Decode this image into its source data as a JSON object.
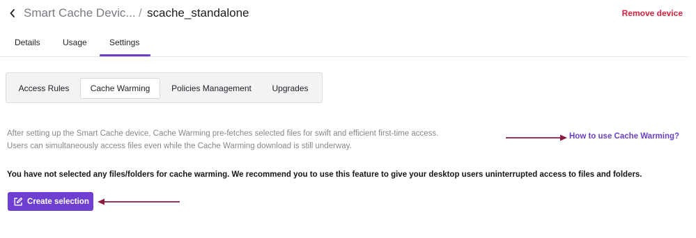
{
  "header": {
    "breadcrumb_parent": "Smart Cache Devic...",
    "breadcrumb_separator": "/",
    "breadcrumb_current": "scache_standalone",
    "remove_label": "Remove device"
  },
  "tabs": [
    {
      "label": "Details",
      "active": false
    },
    {
      "label": "Usage",
      "active": false
    },
    {
      "label": "Settings",
      "active": true
    }
  ],
  "subtabs": [
    {
      "label": "Access Rules",
      "active": false
    },
    {
      "label": "Cache Warming",
      "active": true
    },
    {
      "label": "Policies Management",
      "active": false
    },
    {
      "label": "Upgrades",
      "active": false
    }
  ],
  "content": {
    "description_line1": "After setting up the Smart Cache device, Cache Warming pre-fetches selected files for swift and efficient first-time access.",
    "description_line2": "Users can simultaneously access files even while the Cache Warming download is still underway.",
    "help_link": "How to use Cache Warming?",
    "empty_notice": "You have not selected any files/folders for cache warming. We recommend you to use this feature to give your desktop users uninterrupted access to files and folders.",
    "create_button": "Create selection"
  },
  "icons": {
    "back": "chevron-left-icon",
    "create": "edit-square-icon"
  },
  "colors": {
    "accent": "#6b3fc8",
    "danger": "#d4213d",
    "annotation_arrow": "#8b1a45"
  }
}
